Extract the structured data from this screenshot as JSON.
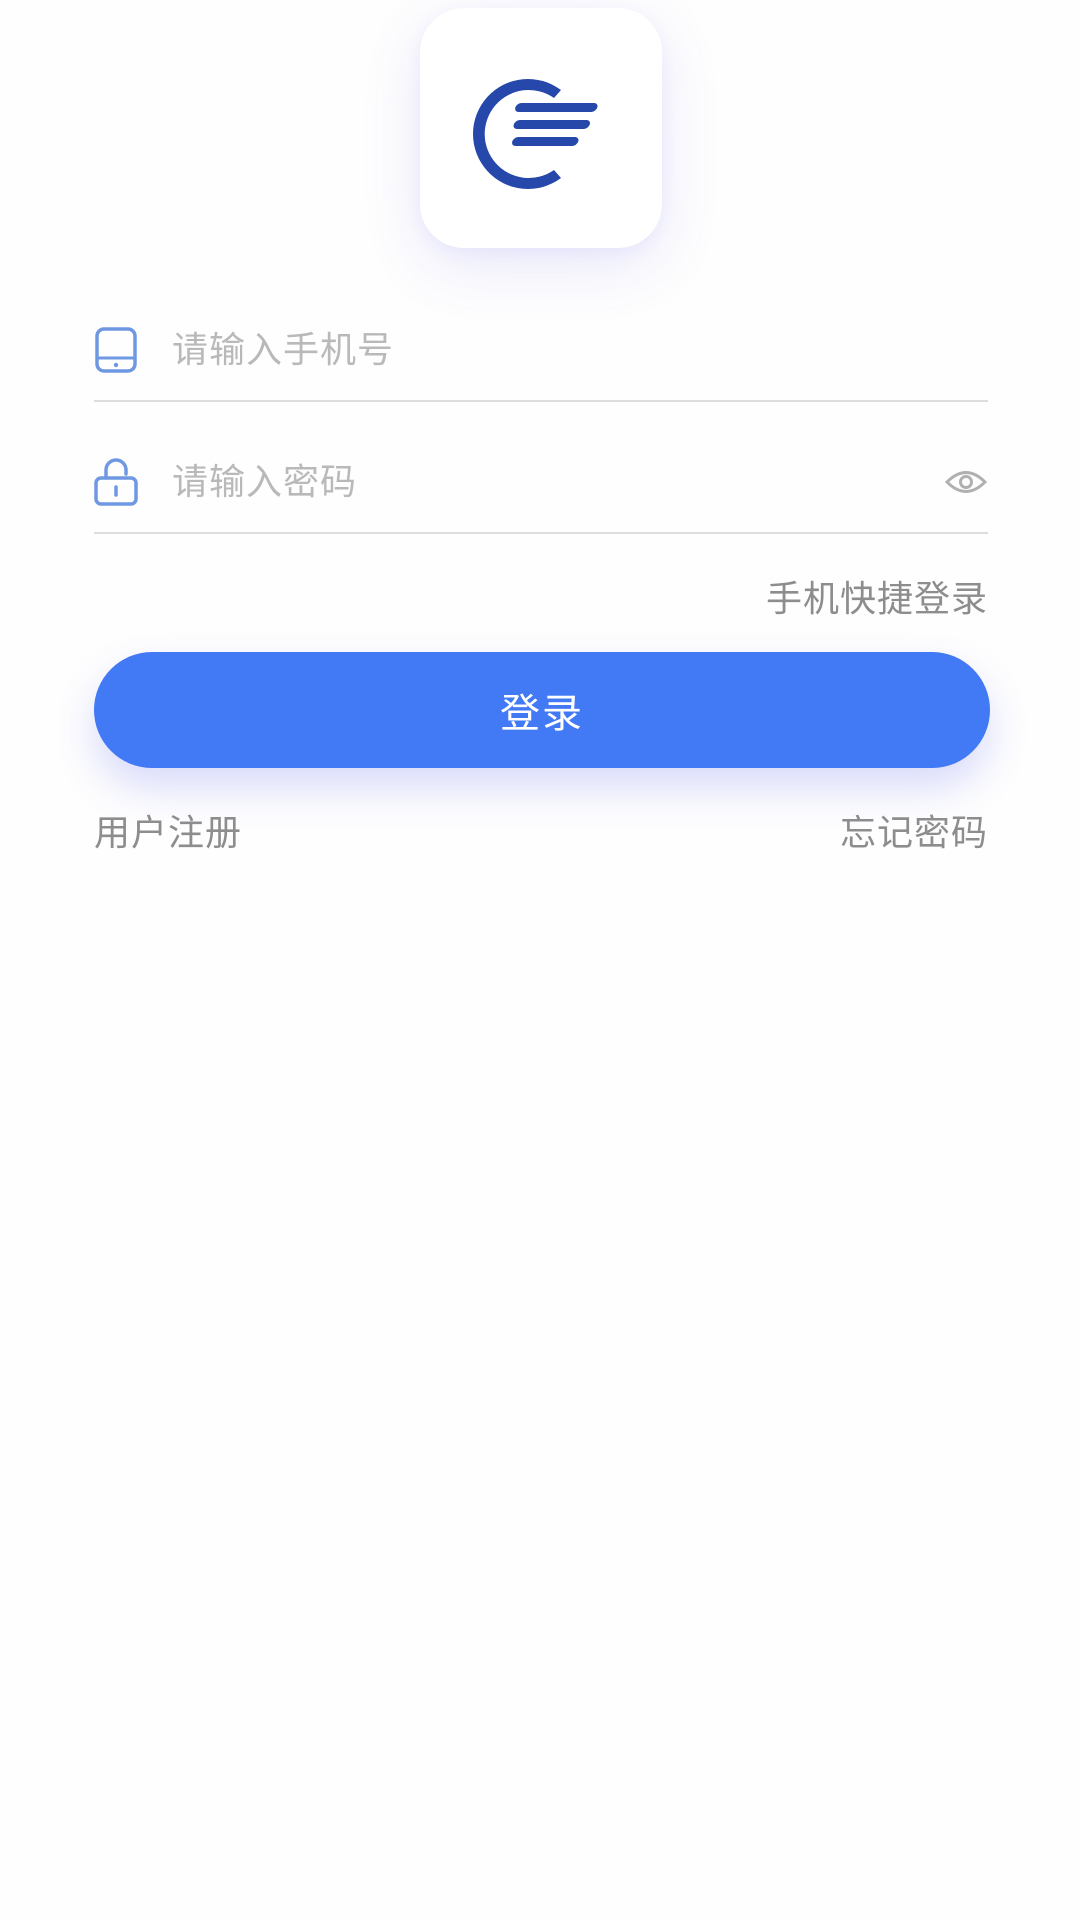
{
  "logo": {
    "icon": "app-logo-icon",
    "color": "#2748ab"
  },
  "phone_field": {
    "placeholder": "请输入手机号",
    "value": "",
    "icon": "phone-icon"
  },
  "password_field": {
    "placeholder": "请输入密码",
    "value": "",
    "icon": "lock-icon",
    "toggle_icon": "eye-icon"
  },
  "quick_login_label": "手机快捷登录",
  "login_button_label": "登录",
  "register_label": "用户注册",
  "forgot_password_label": "忘记密码",
  "colors": {
    "primary": "#4279f5",
    "icon": "#6f98e2",
    "muted_text": "#8d8d8d",
    "placeholder": "#b9b9b9",
    "divider": "#dddddd"
  }
}
